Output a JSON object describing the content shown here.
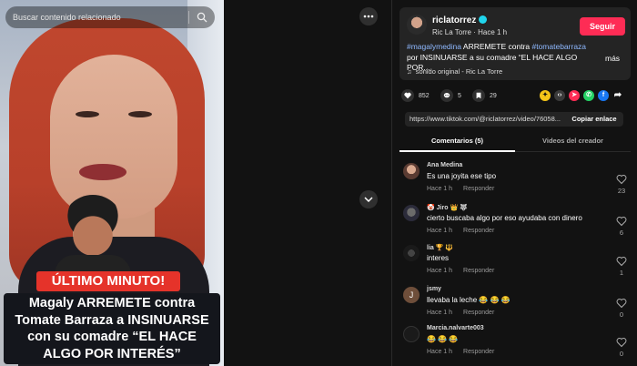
{
  "search": {
    "placeholder": "Buscar contenido relacionado"
  },
  "video": {
    "banner": "ÚLTIMO MINUTO!",
    "headline_lines": [
      "Magaly ARREMETE contra",
      "Tomate Barraza a INSINUARSE",
      "con su comadre “EL HACE",
      "ALGO POR INTERÉS”"
    ]
  },
  "post": {
    "username": "riclatorrez",
    "author_line": "Ric La Torre · Hace 1 h",
    "follow_label": "Seguir",
    "caption": {
      "tag1": "#magalymedina",
      "part1": " ARREMETE contra ",
      "tag2": "#tomatebarraza",
      "part2": " por INSINUARSE a su comadre “EL HACE ALGO POR..."
    },
    "more_label": "más",
    "sound": "sonido original - Ric La Torre"
  },
  "actions": {
    "likes": "852",
    "comments": "5",
    "saves": "29"
  },
  "link": {
    "url": "https://www.tiktok.com/@riclatorrez/video/76058...",
    "copy_label": "Copiar enlace"
  },
  "tabs": [
    {
      "label": "Comentarios (5)"
    },
    {
      "label": "Videos del creador"
    }
  ],
  "comments": [
    {
      "name": "Ana Medina",
      "text": "Es una joyita ese tipo",
      "time": "Hace 1 h",
      "reply": "Responder",
      "likes": "23"
    },
    {
      "name": "🤡 Jiro 👑 🐺",
      "text": "cierto buscaba algo por eso ayudaba con dinero",
      "time": "Hace 1 h",
      "reply": "Responder",
      "likes": "6"
    },
    {
      "name": "lia 🏆 🔱",
      "text": "interes",
      "time": "Hace 1 h",
      "reply": "Responder",
      "likes": "1"
    },
    {
      "name": "jsmy",
      "text": "llevaba la leche 😂 😂 😂",
      "time": "Hace 1 h",
      "reply": "Responder",
      "likes": "0"
    },
    {
      "name": "Marcia.nalvarte003",
      "text": "😂 😂 😂",
      "time": "Hace 1 h",
      "reply": "Responder",
      "likes": "0"
    }
  ],
  "icons": {
    "more": "more-horizontal-icon",
    "scroll": "chevron-down-icon",
    "like": "heart-icon",
    "comment": "comment-icon",
    "save": "bookmark-icon"
  },
  "colors": {
    "follow": "#fe2c55",
    "hashtag": "#8fb9ff",
    "banner": "#e5332a",
    "verified": "#20d5ec"
  }
}
